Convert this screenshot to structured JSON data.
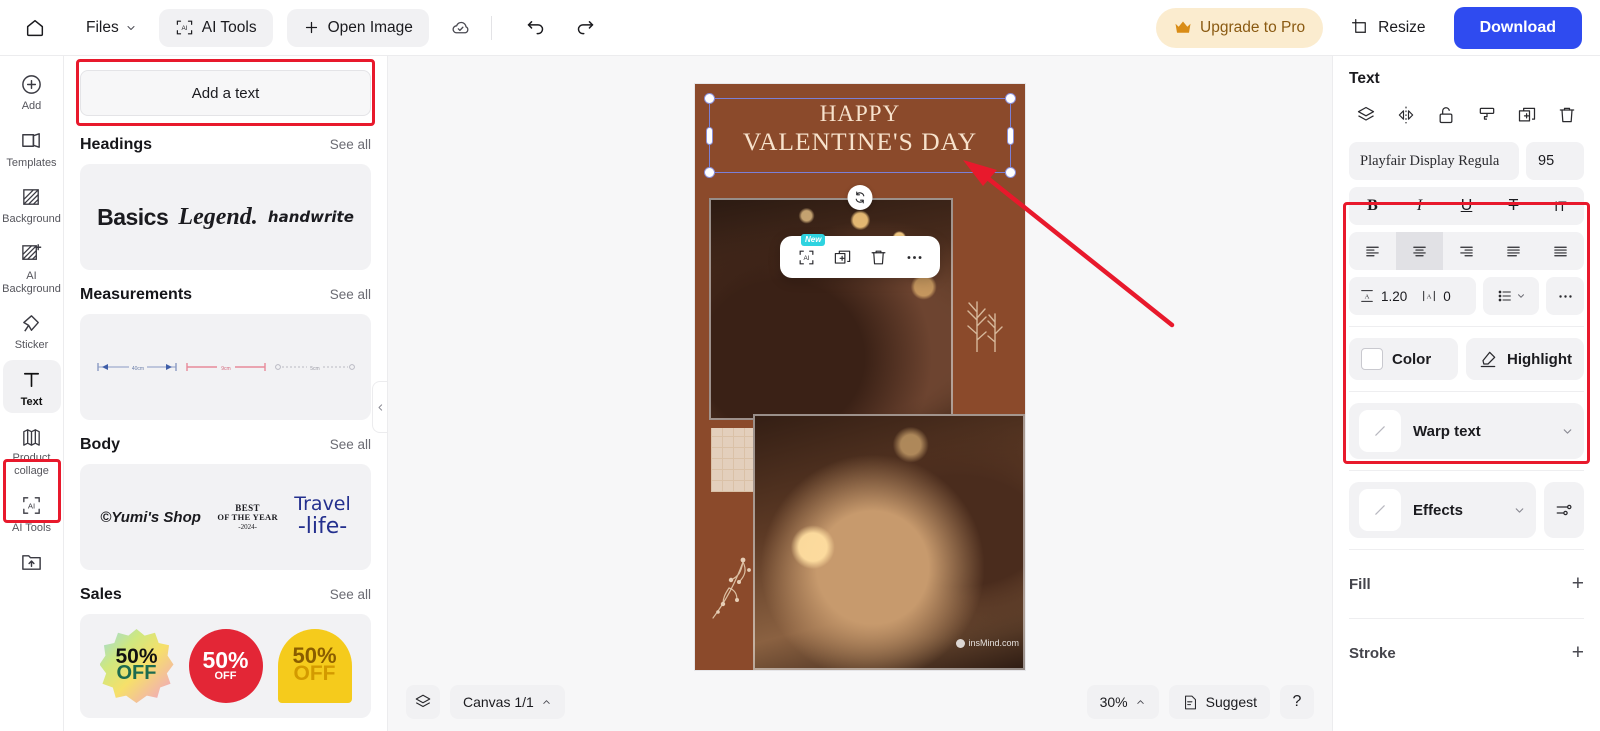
{
  "topbar": {
    "home_icon": "home-icon",
    "files_label": "Files",
    "ai_tools_label": "AI Tools",
    "open_image_label": "Open Image",
    "cloud_icon": "cloud-saved-icon",
    "undo_icon": "undo-icon",
    "redo_icon": "redo-icon",
    "upgrade_label": "Upgrade to Pro",
    "crown_icon": "crown-icon",
    "resize_label": "Resize",
    "resize_icon": "crop-icon",
    "download_label": "Download"
  },
  "rail": {
    "items": [
      {
        "label": "Add",
        "icon": "plus-circle-icon"
      },
      {
        "label": "Templates",
        "icon": "templates-icon"
      },
      {
        "label": "Background",
        "icon": "background-icon"
      },
      {
        "label": "AI Background",
        "icon": "ai-background-icon"
      },
      {
        "label": "Sticker",
        "icon": "sticker-icon"
      },
      {
        "label": "Text",
        "icon": "text-icon"
      },
      {
        "label": "Product collage",
        "icon": "product-collage-icon"
      },
      {
        "label": "AI Tools",
        "icon": "ai-tools-icon"
      },
      {
        "label": "",
        "icon": "upload-folder-icon"
      }
    ],
    "active_index": 5
  },
  "panel": {
    "add_text_label": "Add a text",
    "see_all_label": "See all",
    "sections": [
      {
        "title": "Headings",
        "samples": [
          "Basics",
          "Legend.",
          "handwrite"
        ]
      },
      {
        "title": "Measurements",
        "samples": []
      },
      {
        "title": "Body",
        "samples": [
          "©Yumi's Shop",
          "BEST OF THE YEAR -2024-",
          "Travel -life-"
        ]
      },
      {
        "title": "Sales",
        "samples": [
          "50% OFF",
          "50% OFF",
          "50% OFF"
        ]
      }
    ],
    "body_samples": {
      "yumi": "©Yumi's Shop",
      "best_line1": "BEST",
      "best_line2": "OF THE YEAR",
      "best_line3": "-2024-",
      "travel_line1": "Travel",
      "travel_line2": "-life-"
    },
    "sales_samples": [
      {
        "percent": "50%",
        "off": "OFF"
      },
      {
        "percent": "50%",
        "off": "OFF"
      },
      {
        "percent": "50%",
        "off": "OFF"
      }
    ],
    "collapse_icon": "chevron-left-icon"
  },
  "canvas": {
    "title_line1": "HAPPY",
    "title_line2": "VALENTINE'S DAY",
    "background_color": "#8b4a2b",
    "title_color": "#f7e2cc",
    "watermark": "insMind.com",
    "float_toolbar": {
      "ai_icon": "ai-edit-icon",
      "new_badge": "New",
      "duplicate_icon": "duplicate-icon",
      "delete_icon": "trash-icon",
      "more_icon": "more-horizontal-icon"
    },
    "rotate_icon": "rotate-icon"
  },
  "bottombar": {
    "layers_icon": "layers-icon",
    "canvas_label": "Canvas 1/1",
    "canvas_chevron": "chevron-up-icon",
    "zoom_label": "30%",
    "zoom_chevron": "chevron-up-icon",
    "suggest_label": "Suggest",
    "suggest_icon": "suggest-icon",
    "help_label": "?"
  },
  "rightpanel": {
    "title": "Text",
    "actions": [
      {
        "name": "layers-icon"
      },
      {
        "name": "flip-icon"
      },
      {
        "name": "unlock-icon"
      },
      {
        "name": "format-painter-icon"
      },
      {
        "name": "duplicate-icon"
      },
      {
        "name": "trash-icon"
      }
    ],
    "font_family": "Playfair Display Regula",
    "font_size": "95",
    "style_buttons": [
      {
        "label": "B",
        "name": "bold-button"
      },
      {
        "label": "I",
        "name": "italic-button"
      },
      {
        "label": "U",
        "name": "underline-button"
      },
      {
        "label": "T",
        "name": "strikethrough-button"
      },
      {
        "label": "IT",
        "name": "vertical-text-button"
      }
    ],
    "align_active_index": 1,
    "line_height_icon": "line-height-icon",
    "line_height": "1.20",
    "letter_spacing_icon": "letter-spacing-icon",
    "letter_spacing": "0",
    "list_icon": "list-icon",
    "more_icon": "more-horizontal-icon",
    "color_label": "Color",
    "color_value": "#ffffff",
    "highlight_label": "Highlight",
    "highlight_icon": "highlighter-icon",
    "warp_text_label": "Warp text",
    "effects_label": "Effects",
    "effects_settings_icon": "sliders-icon",
    "fill_label": "Fill",
    "stroke_label": "Stroke",
    "add_icon": "plus-icon"
  },
  "annotations": {
    "highlight_color": "#e8192c",
    "arrow_color": "#e8192c"
  }
}
